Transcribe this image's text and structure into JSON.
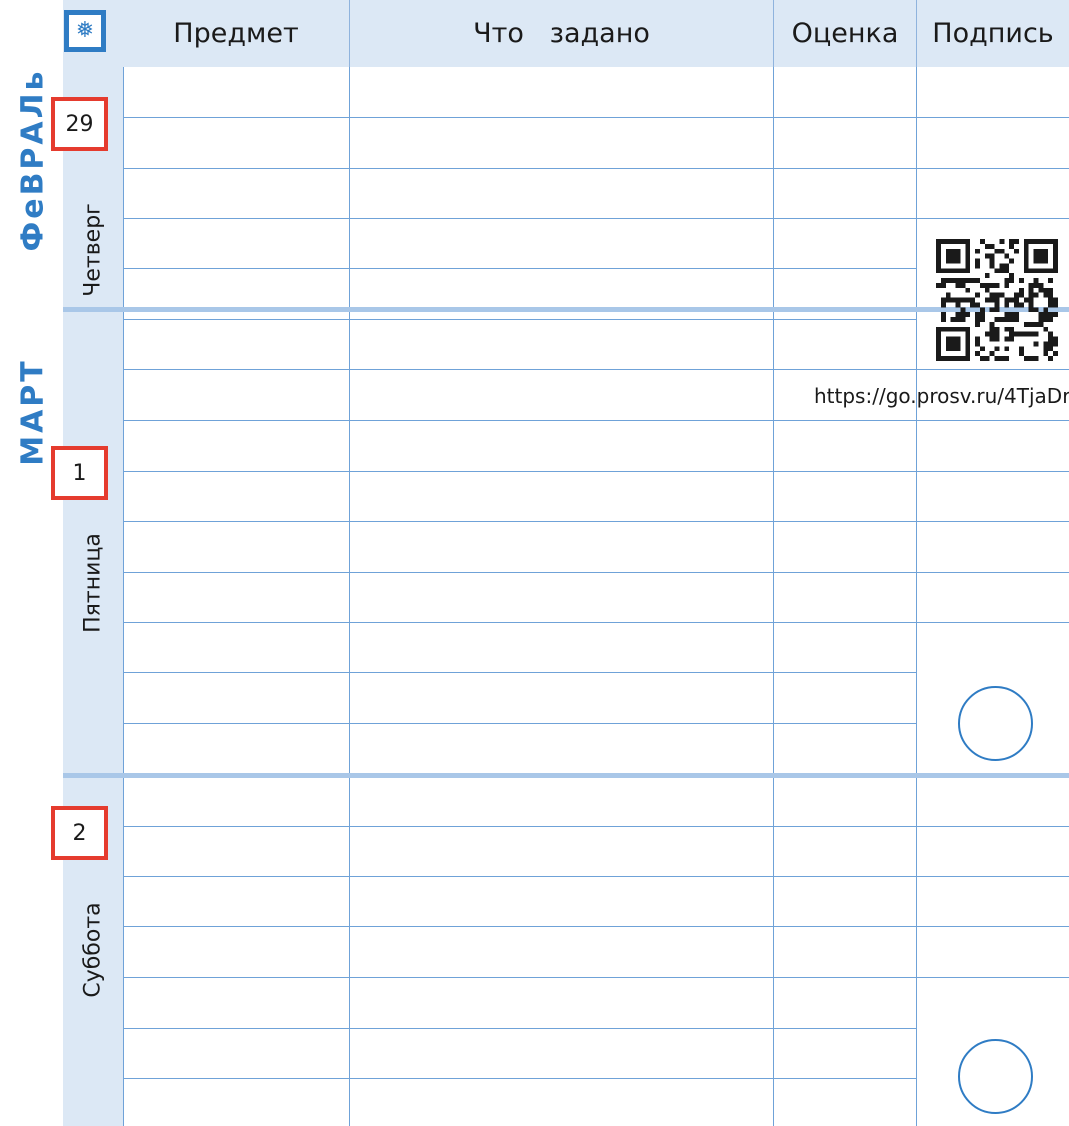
{
  "header": {
    "subject": "Предмет",
    "homework": "Что   задано",
    "grade": "Оценка",
    "signature": "Подпись"
  },
  "months": {
    "february": "ФеВРАЛь",
    "march": "МАРТ"
  },
  "days": [
    {
      "date": "29",
      "weekday": "Четверг"
    },
    {
      "date": "1",
      "weekday": "Пятница"
    },
    {
      "date": "2",
      "weekday": "Суббота"
    }
  ],
  "qr": {
    "url": "https://go.prosv.ru/4TjaDr"
  },
  "colors": {
    "accent": "#2f7cc4",
    "band": "#dce8f5",
    "grid": "#6fa2d8",
    "date_border": "#e53b2e"
  },
  "icons": {
    "logo": "snowflake-icon"
  }
}
